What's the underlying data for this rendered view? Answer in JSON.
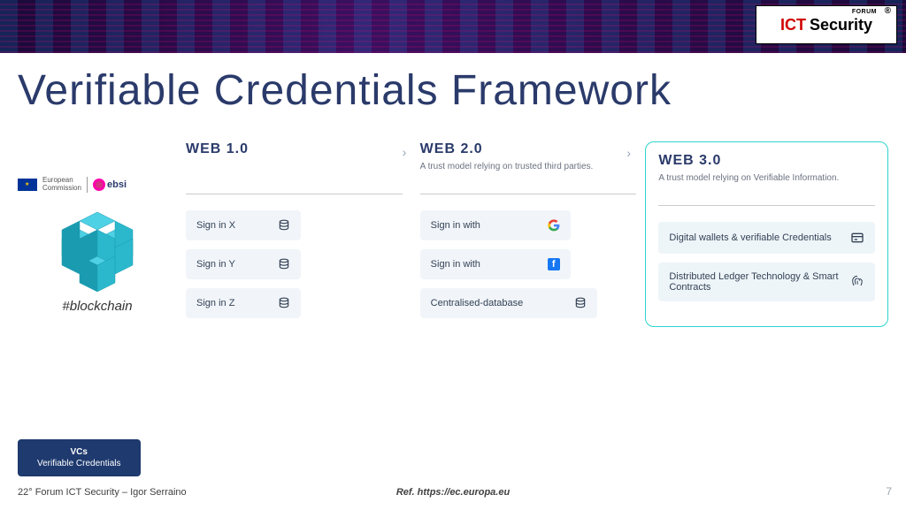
{
  "logo": {
    "ict": "ICT",
    "security": "Security",
    "forum": "FORUM",
    "reg": "®"
  },
  "title": "Verifiable Credentials Framework",
  "left": {
    "eu_label": "European\nCommission",
    "ebsi": "ebsi",
    "hashtag": "#blockchain"
  },
  "columns": {
    "web1": {
      "title": "WEB 1.0",
      "subtitle": "",
      "items": [
        {
          "label": "Sign in X"
        },
        {
          "label": "Sign in Y"
        },
        {
          "label": "Sign in Z"
        }
      ]
    },
    "web2": {
      "title": "WEB 2.0",
      "subtitle": "A trust model relying on trusted third parties.",
      "items": [
        {
          "label": "Sign in with",
          "icon": "google"
        },
        {
          "label": "Sign in with",
          "icon": "facebook"
        },
        {
          "label": "Centralised-database",
          "icon": "db"
        }
      ]
    },
    "web3": {
      "title": "WEB 3.0",
      "subtitle": "A trust model relying on Verifiable Information.",
      "items": [
        {
          "label": "Digital wallets & verifiable Credentials",
          "icon": "card"
        },
        {
          "label": "Distributed Ledger Technology & Smart Contracts",
          "icon": "fingerprint"
        }
      ]
    }
  },
  "legend": {
    "line1": "VCs",
    "line2": "Verifiable Credentials"
  },
  "footer": {
    "left": "22° Forum ICT Security – Igor Serraino",
    "center": "Ref. https://ec.europa.eu",
    "page": "7"
  }
}
